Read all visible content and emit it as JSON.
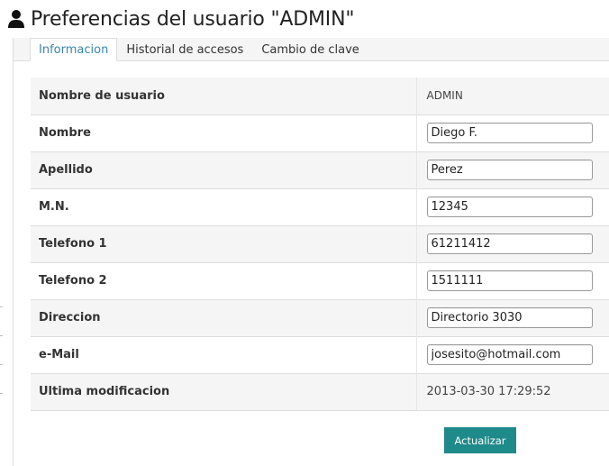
{
  "page": {
    "title": "Preferencias del usuario \"ADMIN\""
  },
  "tabs": [
    {
      "label": "Informacion",
      "active": true
    },
    {
      "label": "Historial de accesos",
      "active": false
    },
    {
      "label": "Cambio de clave",
      "active": false
    }
  ],
  "form": {
    "rows": [
      {
        "label": "Nombre de usuario",
        "value": "ADMIN"
      },
      {
        "label": "Nombre",
        "value": "Diego F."
      },
      {
        "label": "Apellido",
        "value": "Perez"
      },
      {
        "label": "M.N.",
        "value": "12345"
      },
      {
        "label": "Telefono 1",
        "value": "61211412"
      },
      {
        "label": "Telefono 2",
        "value": "1511111"
      },
      {
        "label": "Direccion",
        "value": "Directorio 3030"
      },
      {
        "label": "e-Mail",
        "value": "josesito@hotmail.com"
      },
      {
        "label": "Ultima modificacion",
        "value": "2013-03-30 17:29:52"
      }
    ]
  },
  "actions": {
    "submit_label": "Actualizar"
  },
  "colors": {
    "accent": "#1e8a8a",
    "active_tab": "#3a87ad",
    "stripe": "#f5f5f5"
  },
  "icons": {
    "header": "user-icon"
  }
}
